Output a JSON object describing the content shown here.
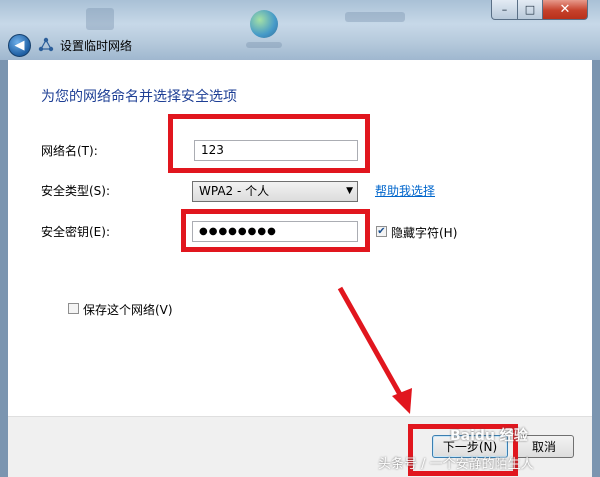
{
  "window": {
    "title": "设置临时网络",
    "close_glyph": "✕",
    "minimize_glyph": "–",
    "maximize_glyph": "□",
    "back_glyph": "◀"
  },
  "form": {
    "heading": "为您的网络命名并选择安全选项",
    "network_name_label": "网络名(T):",
    "network_name_value": "123",
    "security_type_label": "安全类型(S):",
    "security_type_value": "WPA2 - 个人",
    "help_link": "帮助我选择",
    "security_key_label": "安全密钥(E):",
    "security_key_value": "●●●●●●●●",
    "hide_chars_label": "隐藏字符(H)",
    "hide_chars_checked": true,
    "save_network_label": "保存这个网络(V)",
    "save_network_checked": false
  },
  "footer": {
    "next_label": "下一步(N)",
    "cancel_label": "取消"
  },
  "watermarks": {
    "source": "头条号 / 一个安静的陌生人",
    "baidu": "Baidu 经验"
  },
  "colors": {
    "annotation_red": "#e1161e",
    "heading_blue": "#1e3f95",
    "link_blue": "#0066cc"
  }
}
